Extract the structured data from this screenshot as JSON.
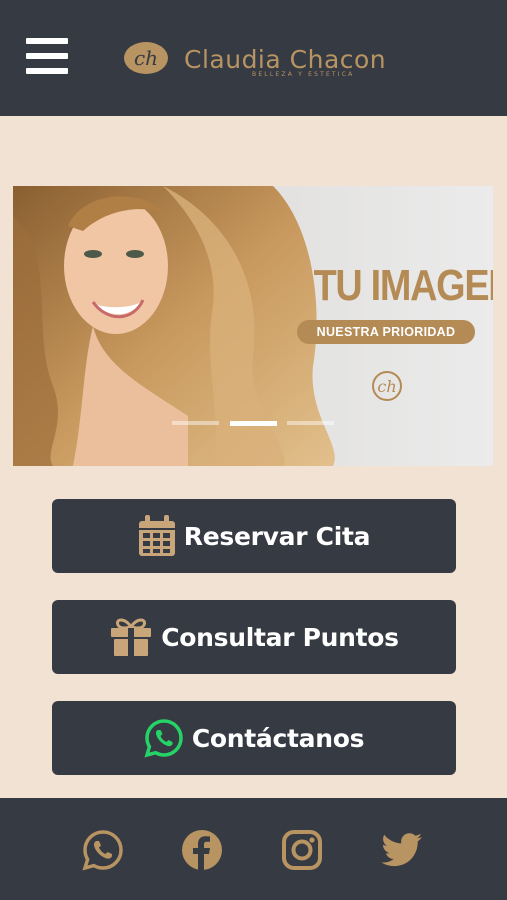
{
  "header": {
    "menu_icon": "hamburger-menu-icon",
    "brand_name": "Claudia Chacon",
    "brand_subtitle": "BELLEZA Y ESTETICA",
    "brand_monogram": "ch"
  },
  "banner": {
    "title": "TU IMAGEN",
    "tagline": "NUESTRA PRIORIDAD",
    "monogram": "ch",
    "slides": 3,
    "active_slide": 2
  },
  "actions": [
    {
      "label": "Reservar Cita",
      "icon": "calendar-icon"
    },
    {
      "label": "Consultar Puntos",
      "icon": "gift-icon"
    },
    {
      "label": "Contáctanos",
      "icon": "whatsapp-icon"
    }
  ],
  "footer": {
    "social": [
      "whatsapp-icon",
      "facebook-icon",
      "instagram-icon",
      "twitter-icon"
    ]
  },
  "colors": {
    "dark": "#363a42",
    "gold": "#b89463",
    "background": "#f1e2d4",
    "whatsapp_green": "#25d366"
  }
}
